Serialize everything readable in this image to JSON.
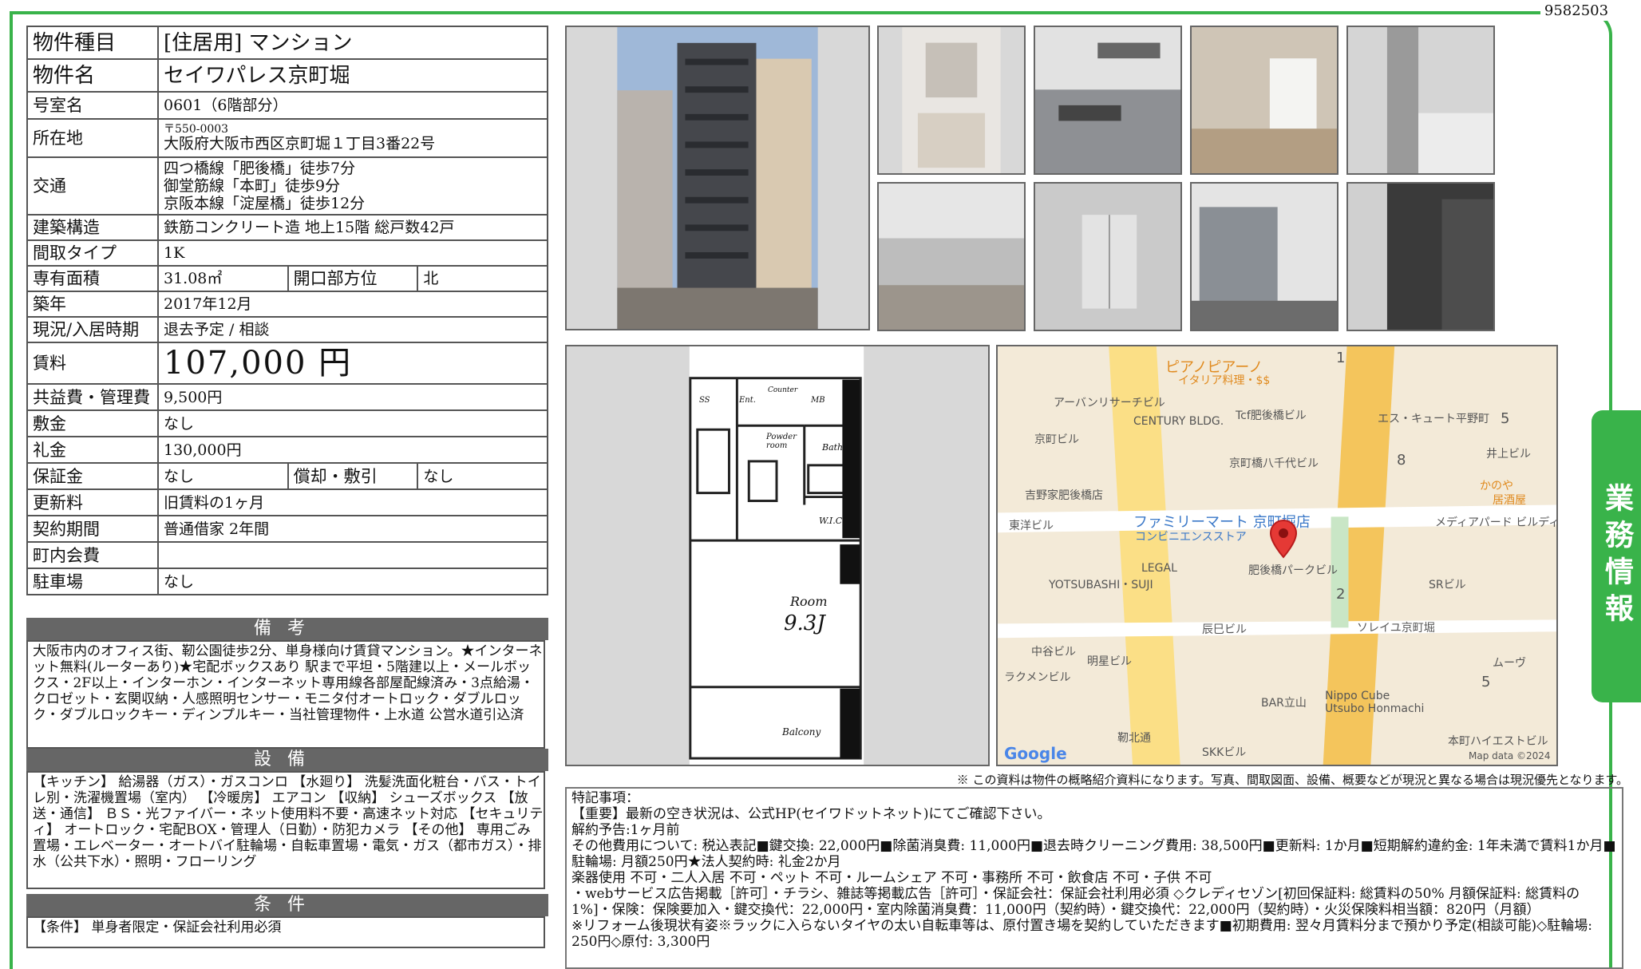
{
  "doc_id": "9582503",
  "side_tab": "業務情報",
  "property": {
    "type_label": "物件種目",
    "type_value": "[住居用]  マンション",
    "name_label": "物件名",
    "name_value": "セイワパレス京町堀",
    "room_label": "号室名",
    "room_value": "0601（6階部分）",
    "address_label": "所在地",
    "zip": "〒550-0003",
    "address": "大阪府大阪市西区京町堀１丁目3番22号",
    "transport_label": "交通",
    "transport": [
      "四つ橋線「肥後橋」徒歩7分",
      "御堂筋線「本町」徒歩9分",
      "京阪本線「淀屋橋」徒歩12分"
    ],
    "structure_label": "建築構造",
    "structure_value": "鉄筋コンクリート造 地上15階 総戸数42戸",
    "layout_label": "間取タイプ",
    "layout_value": "1K",
    "area_label": "専有面積",
    "area_value": "31.08㎡",
    "facing_label": "開口部方位",
    "facing_value": "北",
    "built_label": "築年",
    "built_value": "2017年12月",
    "status_label": "現況/入居時期",
    "status_value": "退去予定 /  相談",
    "rent_label": "賃料",
    "rent_value": "107,000 円",
    "fee_label": "共益費・管理費",
    "fee_value": "9,500円",
    "deposit_label": "敷金",
    "deposit_value": "なし",
    "keymoney_label": "礼金",
    "keymoney_value": "130,000円",
    "guarantee_label": "保証金",
    "guarantee_value": "なし",
    "amort_label": "償却・敷引",
    "amort_value": "なし",
    "renewal_label": "更新料",
    "renewal_value": "旧賃料の1ヶ月",
    "contract_label": "契約期間",
    "contract_value": "普通借家 2年間",
    "community_label": "町内会費",
    "community_value": "",
    "parking_label": "駐車場",
    "parking_value": "なし"
  },
  "remarks": {
    "heading": "備考",
    "text": "大阪市内のオフィス街、靭公園徒歩2分、単身様向け賃貸マンション。★インターネット無料(ルーターあり)★宅配ボックスあり\n駅まで平坦・5階建以上・メールボックス・2F以上・インターホン・インターネット専用線各部屋配線済み・3点給湯・クロゼット・玄関収納・人感照明センサー・モニタ付オートロック・ダブルロック・ダブルロックキー・ディンプルキー・当社管理物件・上水道 公営水道引込済"
  },
  "facilities": {
    "heading": "設備",
    "text": "【キッチン】 給湯器（ガス）・ガスコンロ 【水廻り】 洗髪洗面化粧台・バス・トイレ別・洗濯機置場（室内） 【冷暖房】 エアコン 【収納】 シューズボックス 【放送・通信】 ＢＳ・光ファイバー・ネット使用料不要・高速ネット対応 【セキュリティ】 オートロック・宅配BOX・管理人（日勤）・防犯カメラ 【その他】 専用ごみ置場・エレベーター・オートバイ駐輪場・自転車置場・電気・ガス（都市ガス）・排水（公共下水）・照明・フローリング"
  },
  "conditions": {
    "heading": "条件",
    "text": "【条件】 単身者限定・保証会社利用必須"
  },
  "floorplan": {
    "room": "Room",
    "room_size": "9.3J",
    "balcony": "Balcony",
    "bath": "Bath",
    "powder": "Powder room",
    "wic": "W.I.C",
    "ent": "Ent.",
    "ss": "SS",
    "mb": "MB",
    "counter": "Counter"
  },
  "map": {
    "labels": [
      "ピアノピアーノ",
      "イタリア料理・$$",
      "アーバンリサーチビル",
      "CENTURY BLDG.",
      "Tcf肥後橋ビル",
      "エス・キュート平野町",
      "京町ビル",
      "京町橋八千代ビル",
      "井上ビル",
      "かのや",
      "居酒屋",
      "吉野家肥後橋店",
      "東洋ビル",
      "ファミリーマート 京町堀店",
      "コンビニエンスストア",
      "メディアパード ビルディング",
      "LEGAL",
      "YOTSUBASHI・SUJI",
      "肥後橋パークビル",
      "SRビル",
      "辰巳ビル",
      "ソレイユ京町堀",
      "中谷ビル",
      "明星ビル",
      "ラクメンビル",
      "ムーヴ",
      "BAR立山",
      "Nippo Cube",
      "Utsubo Honmachi",
      "靭北通",
      "SKKビル",
      "本町ハイエストビル",
      "Google",
      "Map data ©2024",
      "1",
      "2",
      "5",
      "5",
      "8"
    ]
  },
  "notice": "※  この資料は物件の概略紹介資料になります。写真、間取図面、設備、概要などが現況と異なる場合は現況優先となります。",
  "special": {
    "text": "特記事項：\n【重要】最新の空き状況は、公式HP(セイワドットネット)にてご確認下さい。\n解約予告:1ヶ月前\nその他費用について:  税込表記■鍵交換: 22,000円■除菌消臭費: 11,000円■退去時クリーニング費用: 38,500円■更新料: 1か月■短期解約違約金: 1年未満で賃料1か月■駐輪場: 月額250円★法人契約時: 礼金2か月\n楽器使用  不可・二人入居  不可・ペット  不可・ルームシェア  不可・事務所  不可・飲食店  不可・子供  不可\n・webサービス広告掲載［許可］・チラシ、雑誌等掲載広告［許可］・保証会社：保証会社利用必須 ◇クレディセゾン[初回保証料: 総賃料の50%  月額保証料: 総賃料の1%]・保険：保険要加入・鍵交換代：22,000円・室内除菌消臭費：11,000円（契約時）・鍵交換代：22,000円（契約時）・火災保険料相当額：820円（月額）\n※リフォーム後現状有姿※ラックに入らないタイヤの太い自転車等は、原付置き場を契約していただきます■初期費用: 翌々月賃料分まで預かり予定(相談可能)◇駐輪場: 250円◇原付: 3,300円"
  }
}
